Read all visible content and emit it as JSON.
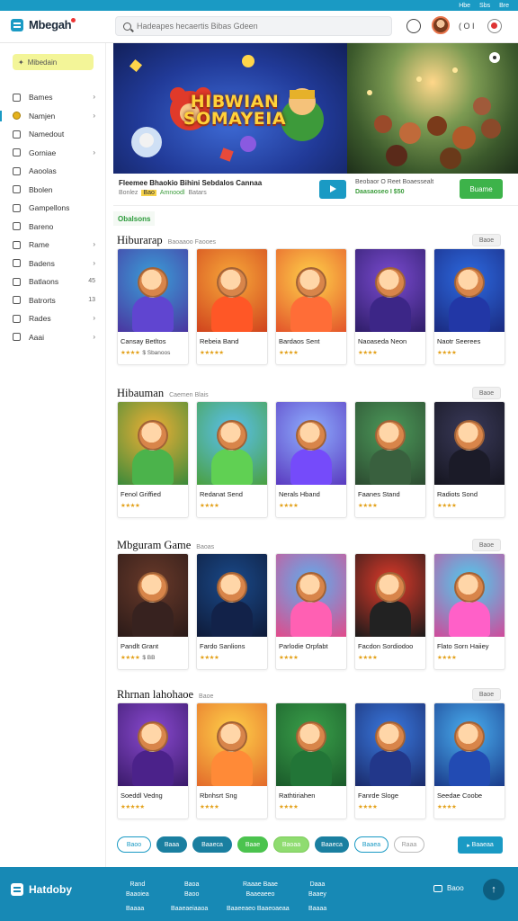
{
  "topbar": {
    "links": [
      "Hbe",
      "Sbs",
      "Bre"
    ]
  },
  "header": {
    "brand": "Mbegah",
    "search_placeholder": "Hadeapes hecaertis Bibas Gdeen",
    "user_text": "( O I"
  },
  "sidebar": {
    "promo": "Mibedain",
    "items": [
      {
        "label": "Bames",
        "icon": "grid-icon",
        "chev": true
      },
      {
        "label": "Namjen",
        "icon": "coin-icon",
        "chev": true,
        "active": true
      },
      {
        "label": "Namedout",
        "icon": "box-icon"
      },
      {
        "label": "Gorniae",
        "icon": "box-icon",
        "chev": true
      },
      {
        "label": "Aaoolas",
        "icon": "box-icon"
      },
      {
        "label": "Bbolen",
        "icon": "disc-icon"
      },
      {
        "label": "Gampellons",
        "icon": "puzzle-icon"
      },
      {
        "label": "Bareno",
        "icon": "box-icon"
      },
      {
        "label": "Rame",
        "icon": "box-icon",
        "chev": true
      },
      {
        "label": "Badens",
        "icon": "pen-icon",
        "chev": true
      },
      {
        "label": "Batlaons",
        "icon": "edit-icon",
        "count": "45"
      },
      {
        "label": "Batrorts",
        "icon": "box-icon",
        "count": "13"
      },
      {
        "label": "Rades",
        "icon": "home-icon",
        "chev": true
      },
      {
        "label": "Aaai",
        "icon": "record-icon",
        "chev": true
      }
    ]
  },
  "hero": {
    "title_line1": "HIBWIAN",
    "title_line2": "SOMAYEIA"
  },
  "featured": {
    "title": "Fleemee Bhaokio Bihini Sebdalos Cannaa",
    "sub_1": "Bonlez",
    "sub_tag": "Bao",
    "sub_green": "Amnoodl",
    "sub_rest": "Batars",
    "info_1": "Beobaor O Reet Boaessealt",
    "info_2": "Daasaoseo I $50",
    "button": "Buame"
  },
  "section_badge": "Obalsons",
  "sections": [
    {
      "title": "Hiburarap",
      "subtitle": "Baoaaoo Faooes",
      "more": "Baoe",
      "cards": [
        {
          "title": "Cansay Betltos",
          "rating": "★★★★",
          "extra": "$ Sbanoos",
          "colors": [
            "#3aa0d8",
            "#4a35a0"
          ]
        },
        {
          "title": "Rebeia Band",
          "rating": "★★★★★",
          "extra": "",
          "colors": [
            "#f7a93a",
            "#d0431d"
          ]
        },
        {
          "title": "Bardaos Sent",
          "rating": "★★★★",
          "extra": "",
          "colors": [
            "#ffd24a",
            "#e3542a"
          ]
        },
        {
          "title": "Naoaseda Neon",
          "rating": "★★★★",
          "extra": "",
          "colors": [
            "#7a4bd0",
            "#2e1d68"
          ]
        },
        {
          "title": "Naotr Seerees",
          "rating": "★★★★",
          "extra": "",
          "colors": [
            "#2d6ae0",
            "#1a2a80"
          ]
        }
      ]
    },
    {
      "title": "Hibauman",
      "subtitle": "Caemen   Blais",
      "more": "Baoe",
      "cards": [
        {
          "title": "Fenol Griffied",
          "rating": "★★★★",
          "extra": "",
          "colors": [
            "#f2b035",
            "#3a8a3a"
          ]
        },
        {
          "title": "Redanat Send",
          "rating": "★★★★",
          "extra": "",
          "colors": [
            "#5ac0f0",
            "#4aa040"
          ]
        },
        {
          "title": "Nerals Hband",
          "rating": "★★★★",
          "extra": "",
          "colors": [
            "#8fb0ff",
            "#5a3ac0"
          ]
        },
        {
          "title": "Faanes Stand",
          "rating": "★★★★",
          "extra": "",
          "colors": [
            "#4c9a5a",
            "#2c4a30"
          ]
        },
        {
          "title": "Radiots Sond",
          "rating": "★★★★",
          "extra": "",
          "colors": [
            "#3a3a5a",
            "#15151f"
          ]
        }
      ]
    },
    {
      "title": "Mbguram Game",
      "subtitle": "Baoas",
      "more": "Baoe",
      "cards": [
        {
          "title": "Pandlt Grant",
          "rating": "★★★★",
          "extra": "$ BB",
          "colors": [
            "#6a3a2a",
            "#2a1a18"
          ]
        },
        {
          "title": "Fardo Sanlions",
          "rating": "★★★★",
          "extra": "",
          "colors": [
            "#1a4a8a",
            "#0e1a38"
          ]
        },
        {
          "title": "Parlodie Orpfabt",
          "rating": "★★★★",
          "extra": "",
          "colors": [
            "#5ab0f0",
            "#e24a8a"
          ]
        },
        {
          "title": "Facdon Sordiodoo",
          "rating": "★★★★",
          "extra": "",
          "colors": [
            "#e23a2a",
            "#1a1a1a"
          ]
        },
        {
          "title": "Flato Sorn Haiiey",
          "rating": "★★★★",
          "extra": "",
          "colors": [
            "#4ad0f0",
            "#d04a9a"
          ]
        }
      ]
    },
    {
      "title": "Rhrnan lahohaoe",
      "subtitle": "Baoe",
      "more": "Baoe",
      "cards": [
        {
          "title": "Soeddl Vedng",
          "rating": "★★★★★",
          "extra": "",
          "colors": [
            "#8a4ad0",
            "#3a1a6a"
          ]
        },
        {
          "title": "Rbnhsrt Sng",
          "rating": "★★★★",
          "extra": "",
          "colors": [
            "#ffd24a",
            "#e36a2a"
          ]
        },
        {
          "title": "Rathtiriahen",
          "rating": "★★★★",
          "extra": "",
          "colors": [
            "#3aa04a",
            "#1a5a2a"
          ]
        },
        {
          "title": "Fanrde Sloge",
          "rating": "★★★★",
          "extra": "",
          "colors": [
            "#3a7ae0",
            "#1a2a6a"
          ]
        },
        {
          "title": "Seedae Coobe",
          "rating": "★★★★",
          "extra": "",
          "colors": [
            "#4ab0f0",
            "#1a3a8a"
          ]
        }
      ]
    }
  ],
  "pager": {
    "buttons": [
      {
        "label": "Baoo",
        "style": "outline"
      },
      {
        "label": "Baaa",
        "style": "filled"
      },
      {
        "label": "Baaeca",
        "style": "filled"
      },
      {
        "label": "Baae",
        "style": "green"
      },
      {
        "label": "Baoaa",
        "style": "lightgreen"
      },
      {
        "label": "Baaeca",
        "style": "filled"
      },
      {
        "label": "Baaea",
        "style": "outline"
      },
      {
        "label": "Raaa",
        "style": "gray"
      }
    ],
    "right_button": "Baaeaa"
  },
  "footer": {
    "brand": "Hatdoby",
    "col1": [
      "Rand",
      "Baaoiea"
    ],
    "col2": [
      "Baoa",
      "Baoo"
    ],
    "col3": [
      "Raaae Baae",
      "Baaeaeeo"
    ],
    "col4": [
      "Daaa",
      "Baaey"
    ],
    "bottom_links": [
      "Baaaa",
      "Baaeaeiaaoa",
      "Baaeeaeo Baaeoaeaa",
      "Baaaa"
    ],
    "contact": "Baoo"
  },
  "colors": {
    "accent": "#1a9ac4",
    "green": "#3db34a",
    "footer": "#1789b5"
  }
}
